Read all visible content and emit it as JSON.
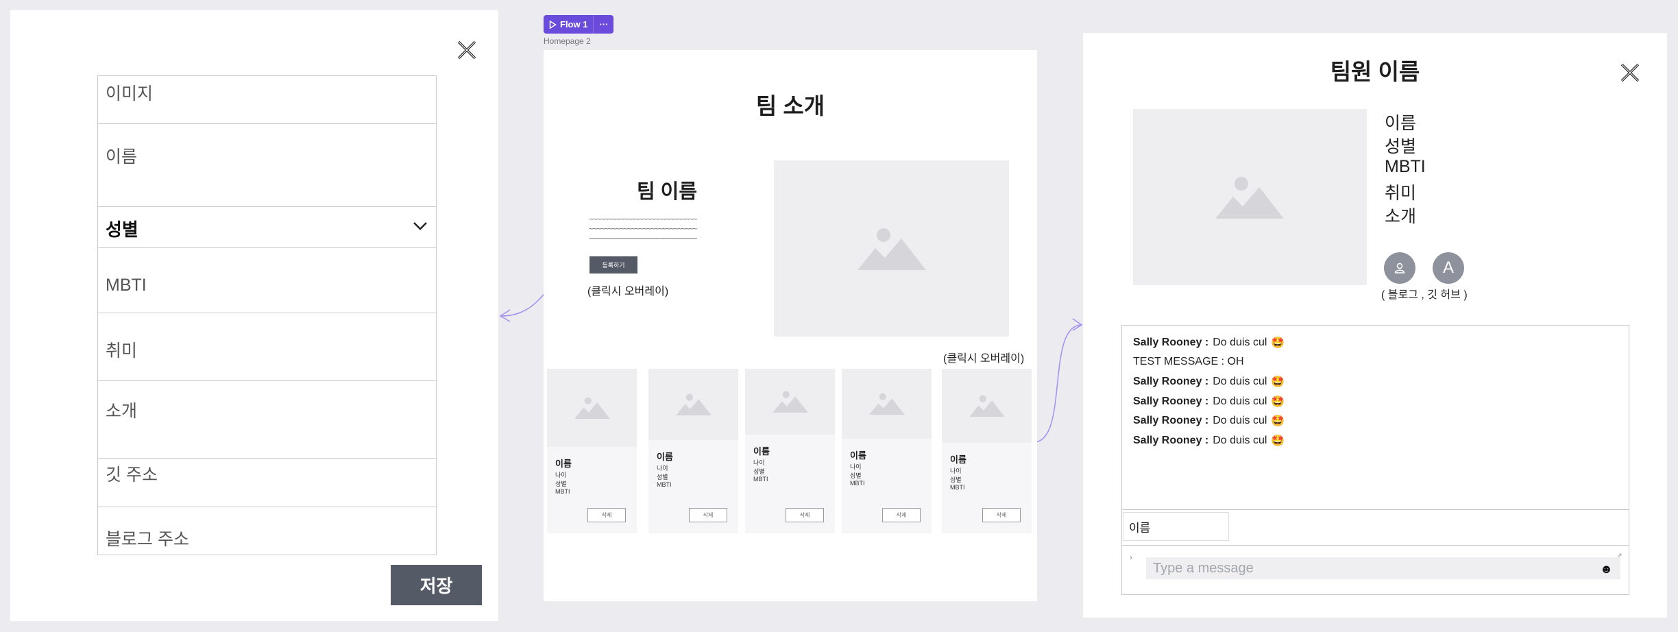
{
  "form_overlay": {
    "fields": {
      "image": "이미지",
      "name": "이름",
      "gender": "성별",
      "mbti": "MBTI",
      "hobby": "취미",
      "intro": "소개",
      "git": "깃 주소",
      "blog": "블로그 주소"
    },
    "save_label": "저장"
  },
  "flow": {
    "tag_label": "Flow 1",
    "more_label": "···",
    "frame_label": "Homepage 2"
  },
  "homepage": {
    "title": "팀 소개",
    "team_name": "팀 이름",
    "tilde_line": "~~~~~~~~~~~~~~~~~~~~~~~~~~~~",
    "register_label": "등록하기",
    "overlay_note": "(클릭시 오버레이)",
    "cards": [
      {
        "name": "이름",
        "age": "나이",
        "gender": "성별",
        "mbti": "MBTI",
        "delete": "삭제"
      },
      {
        "name": "이름",
        "age": "나이",
        "gender": "성별",
        "mbti": "MBTI",
        "delete": "삭제"
      },
      {
        "name": "이름",
        "age": "나이",
        "gender": "성별",
        "mbti": "MBTI",
        "delete": "삭제"
      },
      {
        "name": "이름",
        "age": "나이",
        "gender": "성별",
        "mbti": "MBTI",
        "delete": "삭제"
      },
      {
        "name": "이름",
        "age": "나이",
        "gender": "성별",
        "mbti": "MBTI",
        "delete": "삭제"
      }
    ]
  },
  "detail_overlay": {
    "title": "팀원 이름",
    "lines": [
      "이름",
      "성별",
      "MBTI",
      "취미",
      "소개"
    ],
    "avatar_letter": "A",
    "links_note": "( 블로그 , 깃 허브 )",
    "messages": [
      {
        "author": "Sally Rooney :",
        "text": "Do duis cul",
        "emoji": "🤩"
      },
      {
        "author": "",
        "text": "TEST MESSAGE : OH",
        "emoji": ""
      },
      {
        "author": "Sally Rooney :",
        "text": "Do duis cul",
        "emoji": "🤩"
      },
      {
        "author": "Sally Rooney :",
        "text": "Do duis cul",
        "emoji": "🤩"
      },
      {
        "author": "Sally Rooney :",
        "text": "Do duis cul",
        "emoji": "🤩"
      },
      {
        "author": "Sally Rooney :",
        "text": "Do duis cul",
        "emoji": "🤩"
      }
    ],
    "name_input_value": "이름",
    "message_placeholder": "Type a message",
    "emoji_button": "☻"
  },
  "colors": {
    "background": "#ebebf0",
    "flow_accent": "#6a4bdc",
    "button_dark": "#545a66",
    "connector": "#a48ef0"
  },
  "icons": {
    "close": "close-icon",
    "chevron": "chevron-down-icon",
    "image_placeholder": "image-placeholder-icon",
    "play": "play-icon",
    "person": "person-icon",
    "emoji": "emoji-icon"
  }
}
